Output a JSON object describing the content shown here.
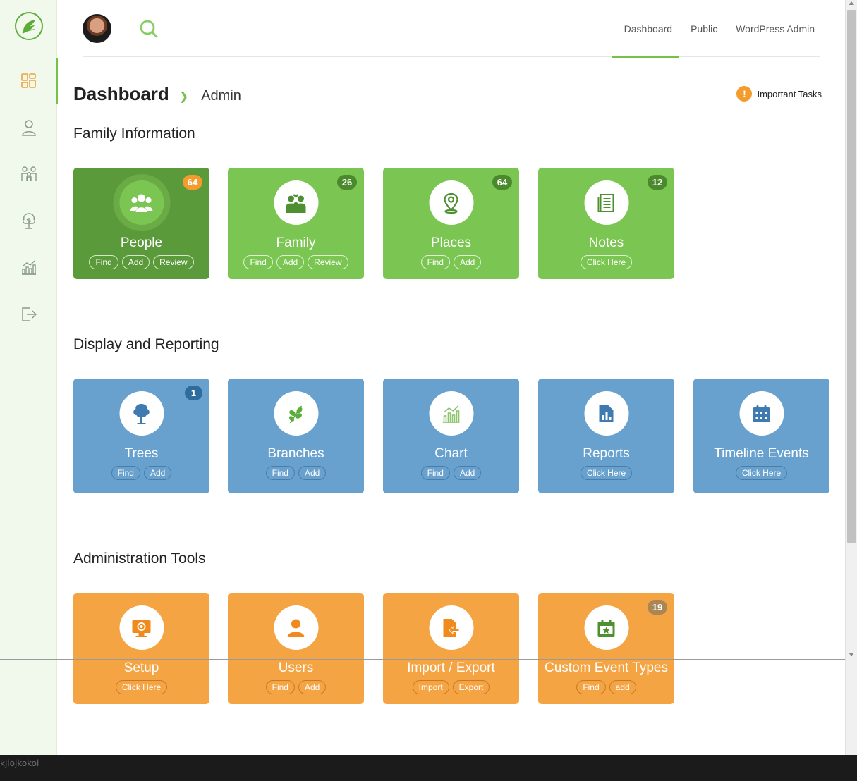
{
  "header": {
    "nav": [
      "Dashboard",
      "Public",
      "WordPress Admin"
    ],
    "active_nav": "Dashboard"
  },
  "sidebar": {
    "items": [
      {
        "icon": "dashboard-grid-icon",
        "active": true
      },
      {
        "icon": "person-icon",
        "active": false
      },
      {
        "icon": "family-icon",
        "active": false
      },
      {
        "icon": "tree-icon",
        "active": false
      },
      {
        "icon": "chart-icon",
        "active": false
      },
      {
        "icon": "logout-icon",
        "active": false
      }
    ]
  },
  "page": {
    "title": "Dashboard",
    "breadcrumb": "Admin",
    "important_tasks": "Important Tasks"
  },
  "sections": [
    {
      "title": "Family Information",
      "color": "#7bc652",
      "cards": [
        {
          "title": "People",
          "badge": "64",
          "icon": "people-icon",
          "actions": [
            "Find",
            "Add",
            "Review"
          ]
        },
        {
          "title": "Family",
          "badge": "26",
          "icon": "family-icon",
          "actions": [
            "Find",
            "Add",
            "Review"
          ]
        },
        {
          "title": "Places",
          "badge": "64",
          "icon": "map-pin-icon",
          "actions": [
            "Find",
            "Add"
          ]
        },
        {
          "title": "Notes",
          "badge": "12",
          "icon": "notes-icon",
          "actions": [
            "Click Here"
          ]
        }
      ]
    },
    {
      "title": "Display and Reporting",
      "color": "#68a0ce",
      "cards": [
        {
          "title": "Trees",
          "badge": "1",
          "icon": "tree-icon",
          "actions": [
            "Find",
            "Add"
          ]
        },
        {
          "title": "Branches",
          "badge": null,
          "icon": "branch-icon",
          "actions": [
            "Find",
            "Add"
          ]
        },
        {
          "title": "Chart",
          "badge": null,
          "icon": "chart-icon",
          "actions": [
            "Find",
            "Add"
          ]
        },
        {
          "title": "Reports",
          "badge": null,
          "icon": "report-icon",
          "actions": [
            "Click Here"
          ]
        },
        {
          "title": "Timeline Events",
          "badge": null,
          "icon": "calendar-icon",
          "actions": [
            "Click Here"
          ]
        }
      ]
    },
    {
      "title": "Administration Tools",
      "color": "#f5a443",
      "cards": [
        {
          "title": "Setup",
          "badge": null,
          "icon": "setup-icon",
          "actions": [
            "Click Here"
          ]
        },
        {
          "title": "Users",
          "badge": null,
          "icon": "user-icon",
          "actions": [
            "Find",
            "Add"
          ]
        },
        {
          "title": "Import / Export",
          "badge": null,
          "icon": "import-export-icon",
          "actions": [
            "Import",
            "Export"
          ]
        },
        {
          "title": "Custom Event Types",
          "badge": "19",
          "icon": "event-calendar-icon",
          "actions": [
            "Find",
            "add"
          ]
        }
      ]
    }
  ],
  "statusbar": {
    "text": "kjiojkokoi"
  },
  "colors": {
    "accent": "#77c04e",
    "sidebar_bg": "#f1f9ec",
    "orange": "#f5a443",
    "blue": "#68a0ce",
    "green": "#7bc652"
  }
}
